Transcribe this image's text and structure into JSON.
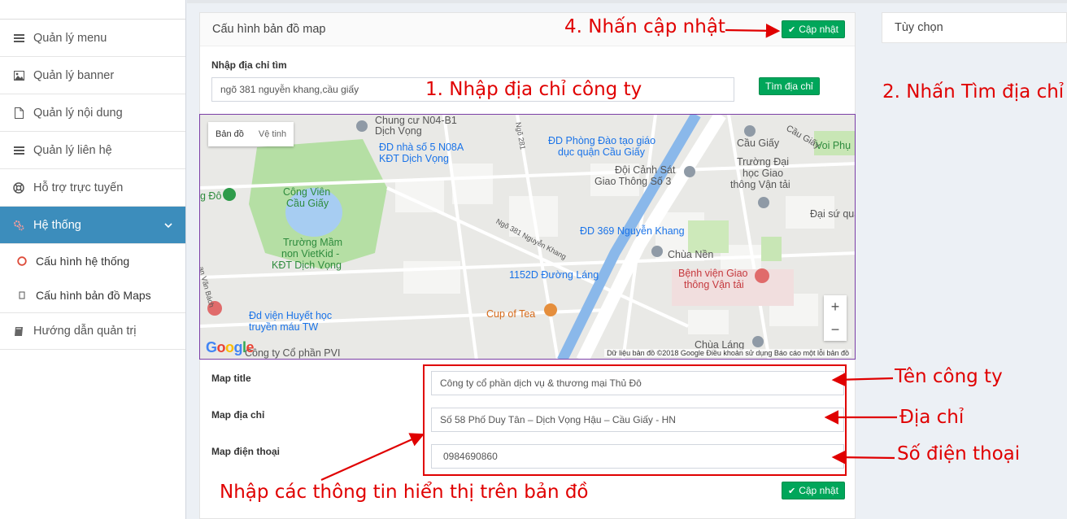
{
  "sidebar": {
    "items": [
      {
        "label": "Quản lý menu",
        "icon": "list-icon"
      },
      {
        "label": "Quản lý banner",
        "icon": "image-icon"
      },
      {
        "label": "Quản lý nội dung",
        "icon": "file-icon"
      },
      {
        "label": "Quản lý liên hệ",
        "icon": "list-icon"
      },
      {
        "label": "Hỗ trợ trực tuyến",
        "icon": "lifebuoy-icon"
      }
    ],
    "active": {
      "label": "Hệ thống",
      "icon": "gears-icon"
    },
    "subitems": [
      {
        "label": "Cấu hình hệ thống",
        "icon": "circle-icon"
      },
      {
        "label": "Cấu hình bản đồ Maps",
        "icon": "square-icon"
      }
    ],
    "last": {
      "label": "Hướng dẫn quản trị",
      "icon": "book-icon"
    }
  },
  "panel": {
    "title": "Cấu hình bản đồ map",
    "update_label": "Cập nhật",
    "search_label": "Nhập địa chỉ tìm",
    "search_value": "ngõ 381 nguyễn khang,cầu giấy",
    "find_label": "Tìm địa chỉ",
    "map_title_label": "Map title",
    "map_title_value": "Công ty cổ phần dịch vụ & thương mại Thủ Đô",
    "map_address_label": "Map địa chỉ",
    "map_address_value": "Số 58 Phố Duy Tân – Dịch Vọng Hậu – Cầu Giấy - HN",
    "map_phone_label": "Map điện thoại",
    "map_phone_value": "0984690860"
  },
  "map": {
    "type_map": "Bản đồ",
    "type_sat": "Vệ tinh",
    "labels": {
      "l1": "Chung cư N04-B1",
      "l2": "Dịch Vọng",
      "l3": "ĐD nhà số 5 N08A",
      "l4": "KĐT Dịch Vọng",
      "l5": "ĐD Phòng Đào tạo giáo",
      "l6": "dục quận Cầu Giấy",
      "l7": "Đội Cảnh Sát",
      "l8": "Giao Thông Số 3",
      "l9": "Cầu Giấy",
      "l10": "Trường Đại",
      "l11": "học Giao",
      "l12": "thông Vận tải",
      "l13": "Voi Phụ",
      "l14": "Công Viên",
      "l15": "Cầu Giấy",
      "l16": "g Đô",
      "l17": "Trường Mầm",
      "l18": "non VietKid -",
      "l19": "KĐT Dịch Vọng",
      "l20": "ĐD 369 Nguyễn Khang",
      "l21": "Chùa Nền",
      "l22": "Bệnh viện Giao",
      "l23": "thông Vận tải",
      "l24": "1152D Đường Láng",
      "l25": "Cup of Tea",
      "l26": "Đd viện Huyết học",
      "l27": "truyền máu TW",
      "l28": "Công ty Cổ phần PVI",
      "l29": "Chùa Láng",
      "l30": "Đại sứ quá",
      "l31": "Ngõ 381 Nguyễn Khang",
      "l32": "Ngõ 281",
      "l33": "Cầu Giấy",
      "l34": "an Văn Bách"
    },
    "zoom_in": "+",
    "zoom_out": "−",
    "attribution": "Dữ liệu bản đồ ©2018 Google    Điều khoản sử dụng    Báo cáo một lỗi bản đồ",
    "logo": "Google"
  },
  "right_panel": {
    "title": "Tùy chọn"
  },
  "annotations": {
    "step1": "1. Nhập địa chỉ công ty",
    "step2": "2. Nhấn Tìm địa chỉ",
    "step4": "4. Nhấn cập nhật",
    "company": "Tên công ty",
    "address": "Địa chỉ",
    "phone": "Số điện thoại",
    "info": "Nhập các thông tin hiển thị trên bản đồ"
  },
  "colors": {
    "accent": "#3c8dbc",
    "success": "#00a65a",
    "annotation": "#e00000"
  }
}
